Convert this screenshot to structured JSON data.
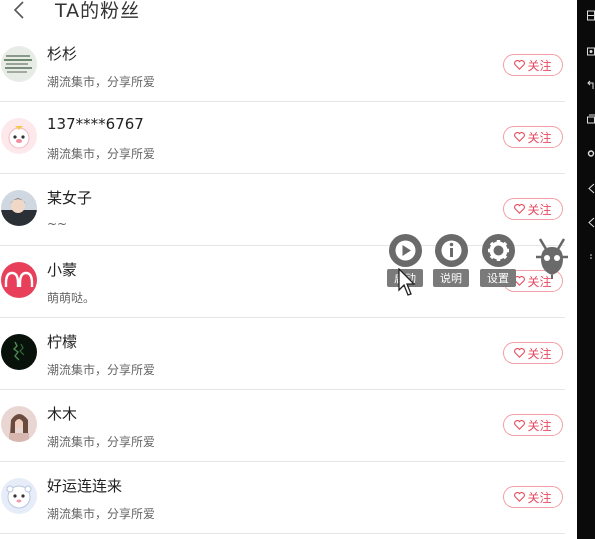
{
  "header": {
    "title": "TA的粉丝"
  },
  "fans": [
    {
      "name": "杉杉",
      "subtitle": "潮流集市，分享所爱",
      "follow_label": "关注"
    },
    {
      "name": "137****6767",
      "subtitle": "潮流集市，分享所爱",
      "follow_label": "关注"
    },
    {
      "name": "某女子",
      "subtitle": "~~",
      "follow_label": "关注"
    },
    {
      "name": "小蒙",
      "subtitle": "萌萌哒。",
      "follow_label": "关注"
    },
    {
      "name": "柠檬",
      "subtitle": "潮流集市，分享所爱",
      "follow_label": "关注"
    },
    {
      "name": "木木",
      "subtitle": "潮流集市，分享所爱",
      "follow_label": "关注"
    },
    {
      "name": "好运连连来",
      "subtitle": "潮流集市，分享所爱",
      "follow_label": "关注"
    }
  ],
  "overlay_tools": [
    {
      "label": "启动",
      "icon": "play-icon"
    },
    {
      "label": "说明",
      "icon": "info-icon"
    },
    {
      "label": "设置",
      "icon": "gear-icon"
    }
  ],
  "colors": {
    "accent": "#e84a5f",
    "follow_border": "#f0a0a8",
    "divider": "#e6e6e6"
  }
}
